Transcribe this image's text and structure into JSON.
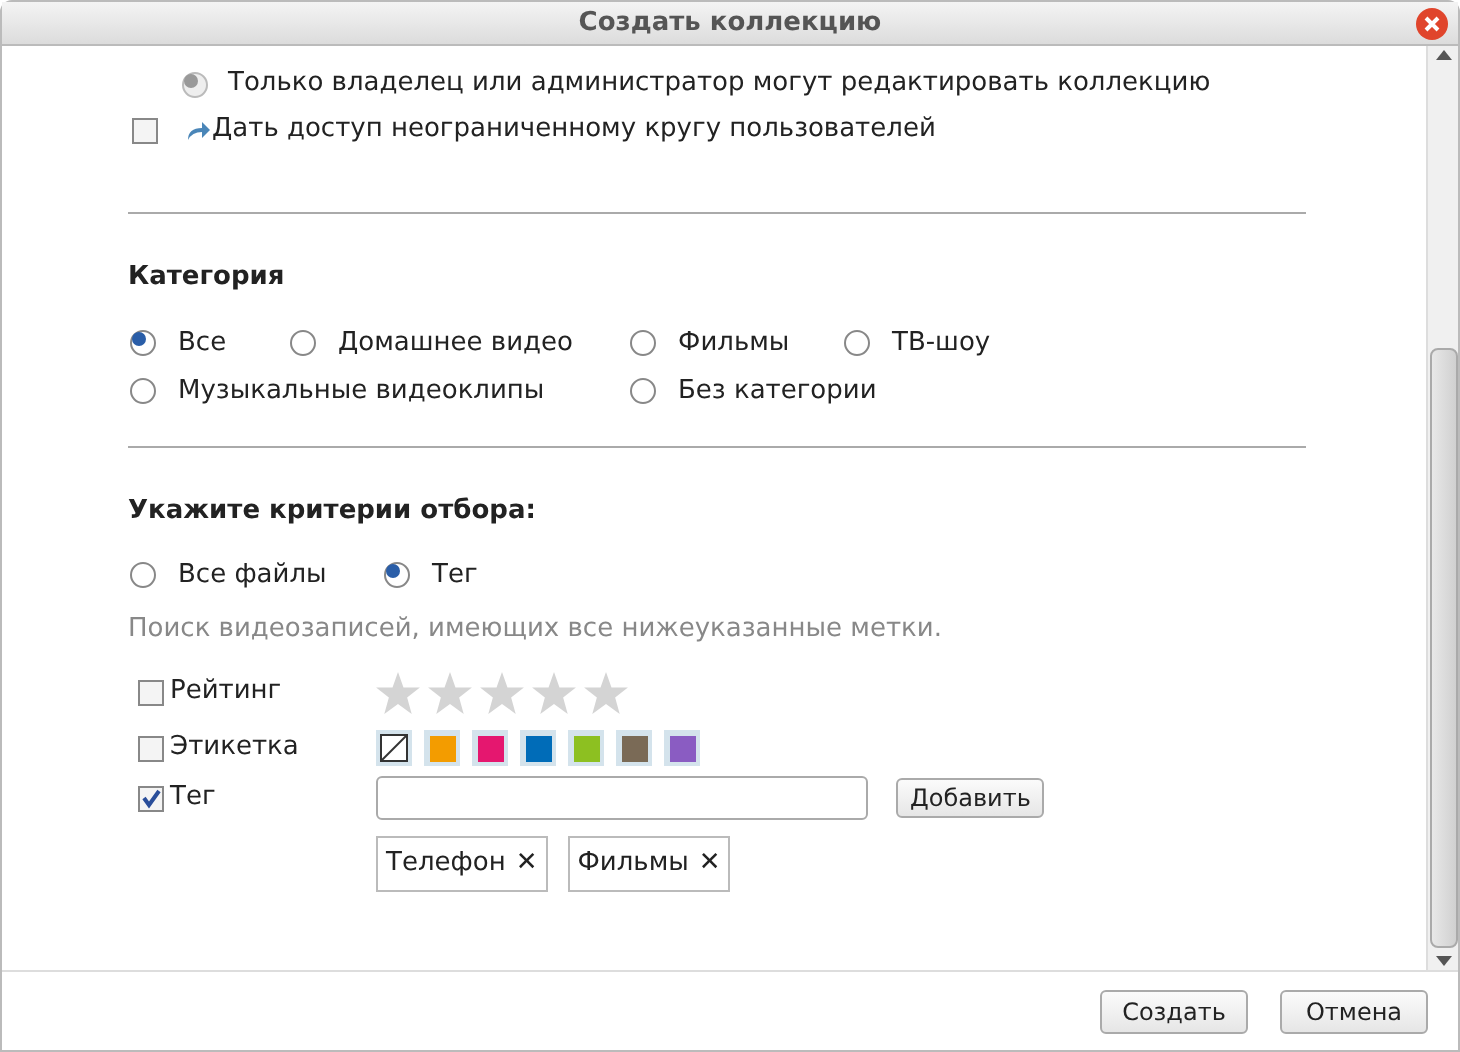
{
  "window": {
    "title": "Создать коллекцию"
  },
  "access": {
    "edit_option": {
      "label": "Только владелец или администратор могут редактировать коллекцию",
      "selected": true,
      "disabled": true
    },
    "public": {
      "label": "Дать доступ неограниченному кругу пользователей",
      "checked": false
    }
  },
  "category": {
    "heading": "Категория",
    "options": [
      {
        "label": "Все",
        "selected": true
      },
      {
        "label": "Домашнее видео",
        "selected": false
      },
      {
        "label": "Фильмы",
        "selected": false
      },
      {
        "label": "ТВ-шоу",
        "selected": false
      },
      {
        "label": "Музыкальные видеоклипы",
        "selected": false
      },
      {
        "label": "Без категории",
        "selected": false
      }
    ]
  },
  "criteria": {
    "heading": "Укажите критерии отбора:",
    "modes": [
      {
        "label": "Все файлы",
        "selected": false
      },
      {
        "label": "Тег",
        "selected": true
      }
    ],
    "hint": "Поиск видеозаписей, имеющих все нижеуказанные метки.",
    "rating": {
      "label": "Рейтинг",
      "checked": false,
      "stars": 0
    },
    "labels": {
      "label": "Этикетка",
      "checked": false,
      "swatches": [
        {
          "kind": "none"
        },
        {
          "kind": "color",
          "color": "#f39c00"
        },
        {
          "kind": "color",
          "color": "#e5176f"
        },
        {
          "kind": "color",
          "color": "#006cb8"
        },
        {
          "kind": "color",
          "color": "#8dc021"
        },
        {
          "kind": "color",
          "color": "#7a6a56"
        },
        {
          "kind": "color",
          "color": "#8a5cc2"
        }
      ]
    },
    "tag": {
      "label": "Тег",
      "checked": true,
      "add_button": "Добавить",
      "tags": [
        {
          "label": "Телефон",
          "remove": "✕"
        },
        {
          "label": "Фильмы",
          "remove": "✕"
        }
      ]
    }
  },
  "buttons": [
    "Создать",
    "Отмена"
  ]
}
